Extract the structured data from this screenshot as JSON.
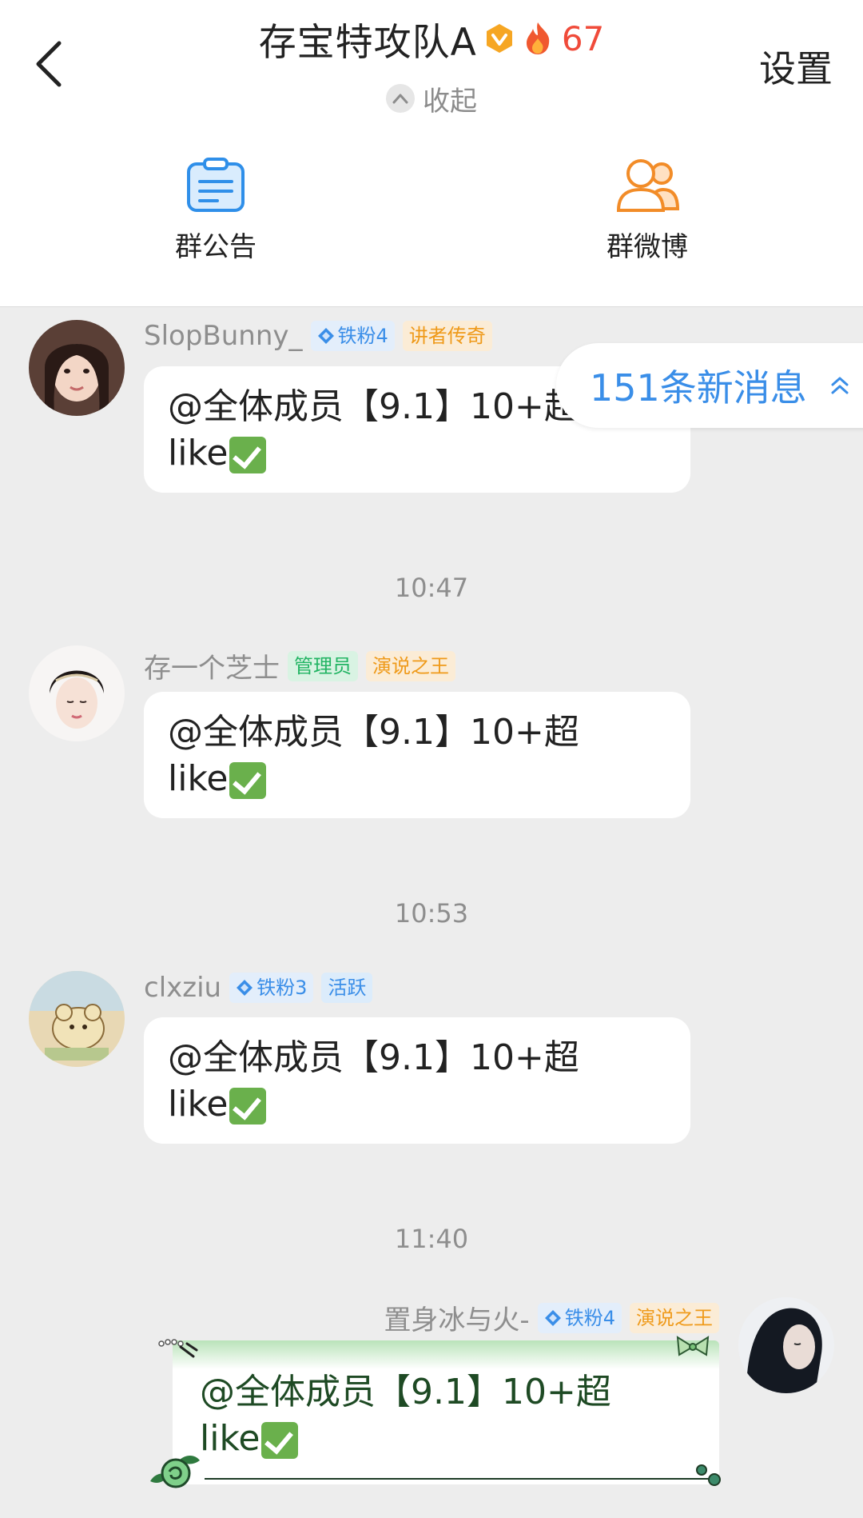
{
  "header": {
    "title": "存宝特攻队A",
    "fire_count": "67",
    "settings_label": "设置",
    "collapse_label": "收起",
    "features": [
      {
        "label": "群公告",
        "icon": "announcement-icon"
      },
      {
        "label": "群微博",
        "icon": "group-weibo-icon"
      }
    ]
  },
  "new_messages": {
    "label": "151条新消息"
  },
  "messages": [
    {
      "sender": "SlopBunny_",
      "tags": [
        "铁粉4",
        "讲者传奇"
      ],
      "line1": "@全体成员【9.1】10+超",
      "line2": "like"
    },
    {
      "time": "10:47",
      "sender": "存一个芝士",
      "tags": [
        "管理员",
        "演说之王"
      ],
      "line1": "@全体成员【9.1】10+超",
      "line2": "like"
    },
    {
      "time": "10:53",
      "sender": "clxziu",
      "tags": [
        "铁粉3",
        "活跃"
      ],
      "line1": "@全体成员【9.1】10+超",
      "line2": "like"
    },
    {
      "time": "11:40",
      "sender": "置身冰与火-",
      "tags": [
        "铁粉4",
        "演说之王"
      ],
      "line1": "@全体成员【9.1】10+超",
      "line2": "like"
    }
  ],
  "colors": {
    "accent_blue": "#3a8ee8",
    "fire_red": "#f04b3a",
    "gold_tag": "#ef9a1a",
    "admin_green": "#22b463",
    "chat_bg": "#ededed"
  }
}
